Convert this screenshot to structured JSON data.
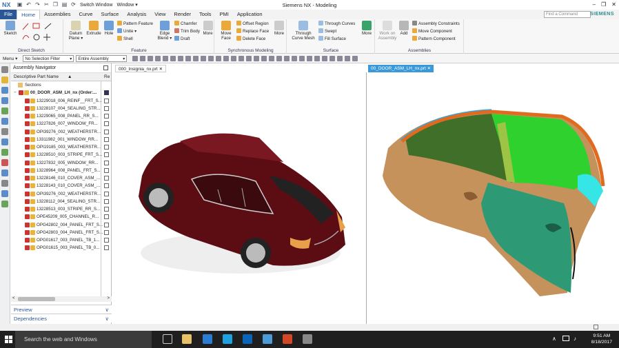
{
  "app": {
    "logo": "NX",
    "window_title": "Siemens NX - Modeling",
    "brand": "SIEMENS",
    "switch_window": "Switch Window",
    "window_menu": "Window ▾"
  },
  "menu": [
    "File",
    "Home",
    "Assemblies",
    "Curve",
    "Surface",
    "Analysis",
    "View",
    "Render",
    "Tools",
    "PMI",
    "Application"
  ],
  "command_search_placeholder": "Find a Command",
  "ribbon": {
    "direct_sketch": {
      "label": "Direct Sketch",
      "sketch": "Sketch"
    },
    "feature": {
      "label": "Feature",
      "datum": "Datum Plane ▾",
      "extrude": "Extrude",
      "hole": "Hole",
      "pattern": "Pattern Feature",
      "unite": "Unite ▾",
      "shell": "Shell",
      "edge_blend": "Edge Blend ▾",
      "chamfer": "Chamfer",
      "trim": "Trim Body",
      "draft": "Draft",
      "more": "More"
    },
    "sync": {
      "label": "Synchronous Modeling",
      "move_face": "Move Face",
      "offset": "Offset Region",
      "replace": "Replace Face",
      "delete": "Delete Face",
      "more": "More"
    },
    "surface": {
      "label": "Surface",
      "through_mesh": "Through Curve Mesh",
      "through": "Through Curves",
      "swept": "Swept",
      "fill": "Fill Surface",
      "more": "More"
    },
    "assemblies": {
      "label": "Assemblies",
      "work": "Work on Assembly",
      "add": "Add",
      "constraints": "Assembly Constraints",
      "move": "Move Component",
      "pattern": "Pattern Component"
    }
  },
  "toolbar": {
    "menu": "Menu ▾",
    "filter": "No Selection Filter",
    "scope": "Entire Assembly"
  },
  "navigator": {
    "title": "Assembly Navigator",
    "col1": "Descriptive Part Name",
    "col2": "Re",
    "sections": "Sections",
    "root": "00_DOOR_ASM_LH_nx (Order:...",
    "items": [
      "13229018_006_REINF__FRT_S...",
      "13228107_004_SEALING_STR...",
      "13229065_008_PANEL_RR_S...",
      "13227826_007_WINDOW_FR...",
      "OPI39276_002_WEATHERSTR...",
      "13311982_001_WINDOW_RR...",
      "OPI19185_003_WEATHERSTR...",
      "13228510_003_STRIPE_FRT_S...",
      "13227832_005_WINDOW_RR...",
      "13228964_008_PANEL_FRT_S...",
      "13228146_010_COVER_ASM_...",
      "13228143_010_COVER_ASM_...",
      "OPI39276_002_WEATHERSTR...",
      "13228112_004_SEALING_STR...",
      "13228513_003_STRIPE_RR_S...",
      "OPE45209_005_CHANNEL_R...",
      "OPG42802_004_PANEL_FRT_S...",
      "OPG42803_004_PANEL_FRT_S...",
      "OPG01617_003_PANEL_TB_1...",
      "OPG01615_003_PANEL_TB_0..."
    ],
    "preview": "Preview",
    "dependencies": "Dependencies"
  },
  "tabs": {
    "part1": "000_Insignia_nx.prt",
    "part2": "00_DOOR_ASM_LH_nx.prt"
  },
  "taskbar": {
    "search": "Search the web and Windows",
    "time": "9:51 AM",
    "date": "8/18/2017"
  }
}
